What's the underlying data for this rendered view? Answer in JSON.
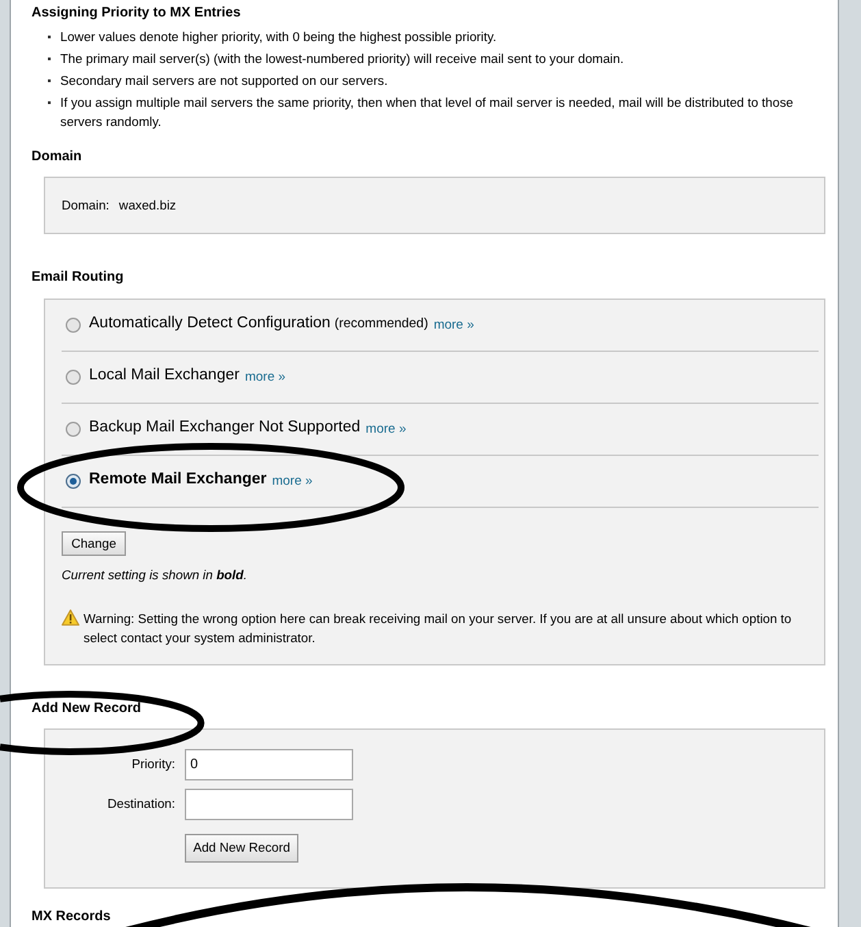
{
  "instructions": {
    "title": "Assigning Priority to MX Entries",
    "items": [
      "Lower values denote higher priority, with 0 being the highest possible priority.",
      "The primary mail server(s) (with the lowest-numbered priority) will receive mail sent to your domain.",
      "Secondary mail servers are not supported on our servers.",
      "If you assign multiple mail servers the same priority, then when that level of mail server is needed, mail will be distributed to those servers randomly."
    ]
  },
  "domain": {
    "title": "Domain",
    "label": "Domain:",
    "value": "waxed.biz"
  },
  "email_routing": {
    "title": "Email Routing",
    "options": [
      {
        "label": "Automatically Detect Configuration",
        "note": "(recommended)",
        "more": "more »",
        "selected": false
      },
      {
        "label": "Local Mail Exchanger",
        "more": "more »",
        "selected": false
      },
      {
        "label": "Backup Mail Exchanger Not Supported",
        "more": "more »",
        "selected": false
      },
      {
        "label": "Remote Mail Exchanger",
        "more": "more »",
        "selected": true
      }
    ],
    "change_button": "Change",
    "current_note": "Current setting is shown in **bold**.",
    "warning": "Warning: Setting the wrong option here can break receiving mail on your server. If you are at all unsure about which option to select contact your system administrator."
  },
  "add_new_record": {
    "title": "Add New Record",
    "fields": [
      {
        "label": "Priority:",
        "value": "0"
      },
      {
        "label": "Destination:"
      }
    ],
    "button": "Add New Record"
  },
  "mx_records": {
    "title": "MX Records"
  }
}
